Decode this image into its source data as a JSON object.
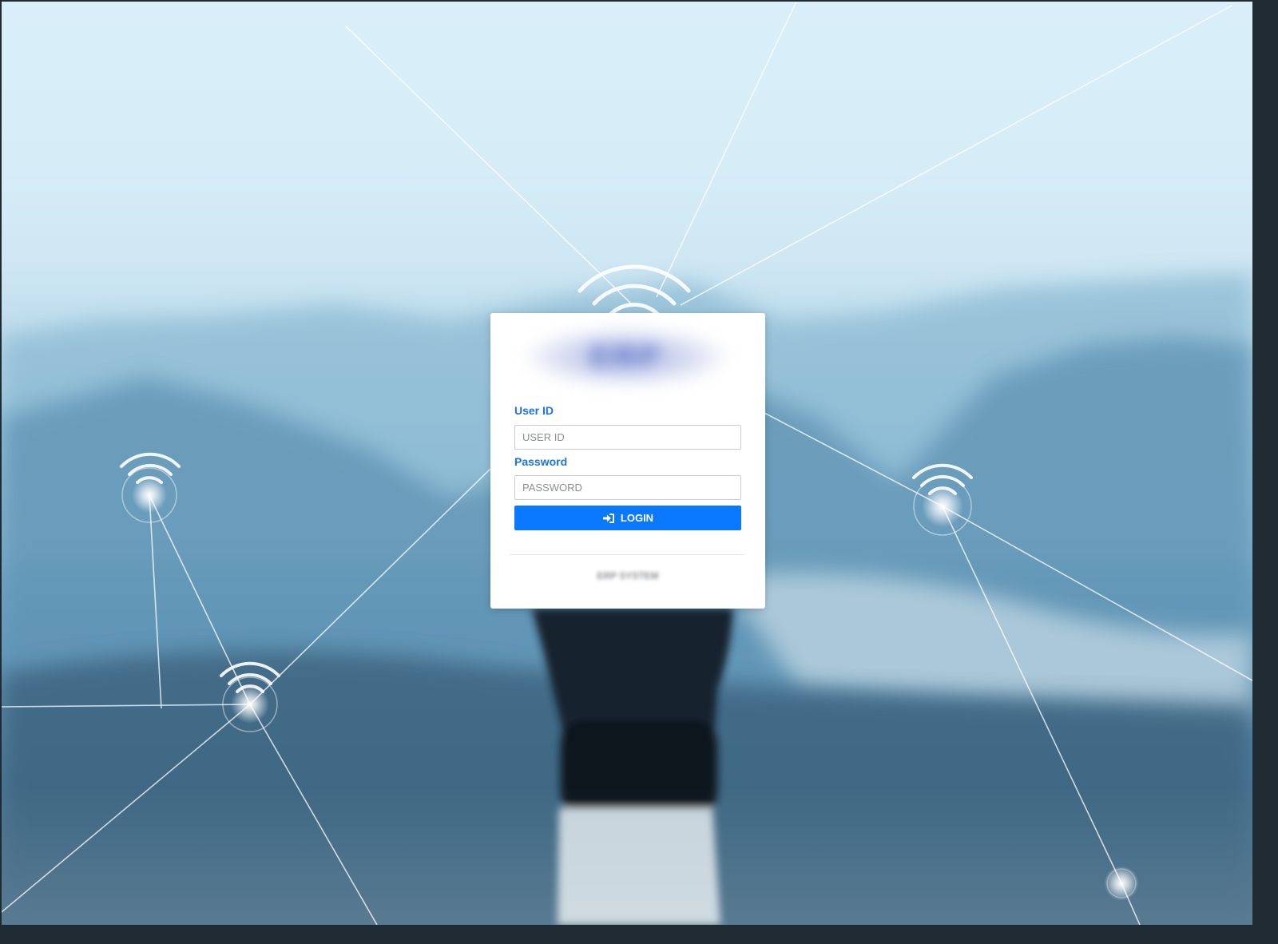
{
  "logo": {
    "text": "ERP"
  },
  "form": {
    "user_id_label": "User ID",
    "user_id_placeholder": "USER ID",
    "user_id_value": "",
    "password_label": "Password",
    "password_placeholder": "PASSWORD",
    "password_value": "",
    "login_label": "LOGIN",
    "login_icon": "sign-in-icon"
  },
  "footer": {
    "text": "ERP SYSTEM"
  },
  "colors": {
    "accent": "#0a78ff",
    "label": "#1a73e8",
    "card": "#ffffff"
  },
  "background": {
    "icons": [
      "wifi-icon",
      "wifi-icon",
      "wifi-icon",
      "wifi-icon",
      "network-node-icon"
    ]
  }
}
